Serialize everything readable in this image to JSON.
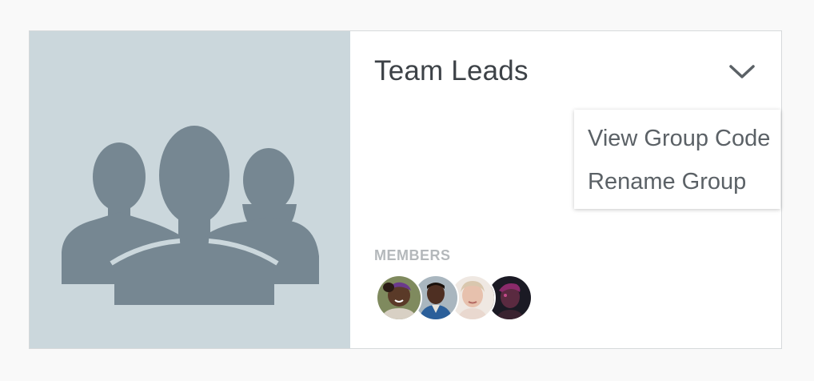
{
  "group": {
    "title": "Team Leads",
    "thumbnail_icon": "group-people-icon",
    "dropdown_icon": "chevron-down-icon"
  },
  "menu": {
    "items": [
      {
        "label": "View Group Code"
      },
      {
        "label": "Rename Group"
      }
    ]
  },
  "members": {
    "label": "MEMBERS",
    "avatars": [
      {
        "icon": "member-avatar-1"
      },
      {
        "icon": "member-avatar-2"
      },
      {
        "icon": "member-avatar-3"
      },
      {
        "icon": "member-avatar-4"
      }
    ]
  },
  "colors": {
    "thumbnail_bg": "#cbd7dc",
    "silhouette": "#768792",
    "title_text": "#3d4247",
    "menu_text": "#5b6166",
    "members_label": "#b4b8bb"
  }
}
